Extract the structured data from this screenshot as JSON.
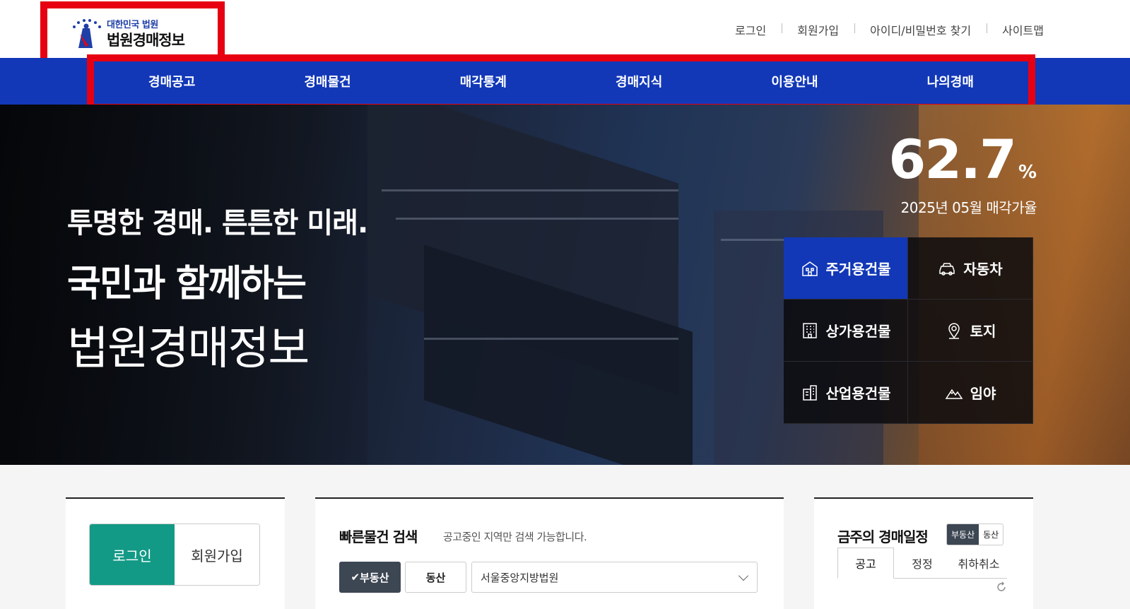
{
  "header": {
    "logo_small": "대한민국 법원",
    "logo_big": "법원경매정보",
    "util_links": [
      "로그인",
      "회원가입",
      "아이디/비밀번호 찾기",
      "사이트맵"
    ]
  },
  "nav": {
    "items": [
      "경매공고",
      "경매물건",
      "매각통계",
      "경매지식",
      "이용안내",
      "나의경매"
    ]
  },
  "hero": {
    "line1": "투명한 경매. 튼튼한 미래.",
    "line2": "국민과 함께하는",
    "line3": "법원경매정보",
    "rate_value": "62.7",
    "rate_unit": "%",
    "rate_label": "2025년 05월 매각가율",
    "categories": [
      {
        "label": "주거용건물",
        "icon": "residential-building-icon",
        "active": true
      },
      {
        "label": "자동차",
        "icon": "car-icon",
        "active": false
      },
      {
        "label": "상가용건물",
        "icon": "commercial-building-icon",
        "active": false
      },
      {
        "label": "토지",
        "icon": "location-pin-icon",
        "active": false
      },
      {
        "label": "산업용건물",
        "icon": "industrial-building-icon",
        "active": false
      },
      {
        "label": "임야",
        "icon": "mountain-icon",
        "active": false
      }
    ]
  },
  "login_panel": {
    "login": "로그인",
    "signup": "회원가입"
  },
  "quick_search": {
    "title": "빠른물건 검색",
    "subtitle": "공고중인 지역만 검색 가능합니다.",
    "real_estate": "부동산",
    "movable": "동산",
    "court_select": "서울중앙지방법원"
  },
  "schedule": {
    "title": "금주의 경매일정",
    "toggle_on": "부동산",
    "toggle_off": "동산",
    "tabs": [
      "공고",
      "정정",
      "취하취소"
    ]
  },
  "colors": {
    "brand_blue": "#1238b8",
    "highlight_red": "#e60012",
    "login_green": "#139a86"
  }
}
